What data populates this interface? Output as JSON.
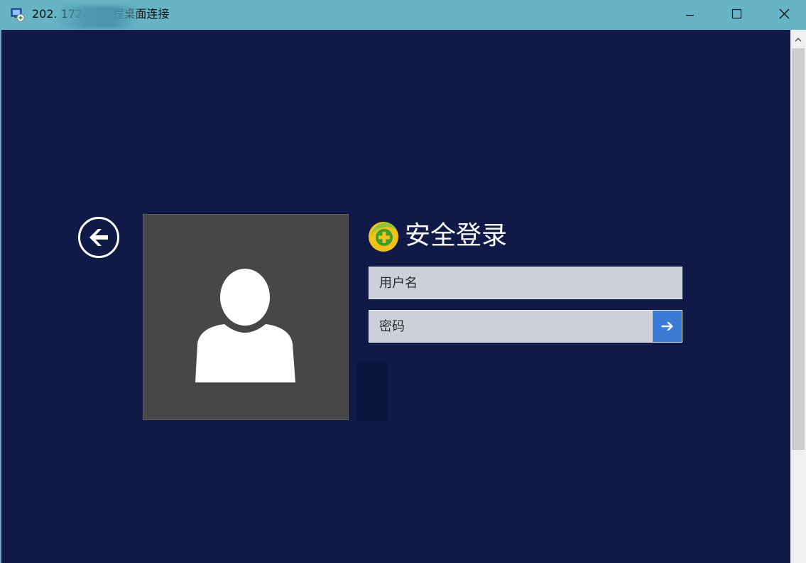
{
  "window": {
    "title": "202.      1721 - 远程桌面连接",
    "app_icon": "remote-desktop-icon",
    "controls": {
      "minimize": "minimize-icon",
      "maximize": "maximize-icon",
      "close": "close-icon"
    }
  },
  "login": {
    "title": "安全登录",
    "title_icon": "360-shield-icon",
    "username_placeholder": "用户名",
    "password_placeholder": "密码",
    "submit_icon": "arrow-right-icon",
    "back_icon": "back-arrow-icon",
    "avatar_icon": "user-silhouette-icon"
  },
  "colors": {
    "titlebar": "#66b4c6",
    "background": "#111a47",
    "avatar_tile": "#474747",
    "input_field": "#ccd0d9",
    "submit_button": "#3a7bd5"
  }
}
